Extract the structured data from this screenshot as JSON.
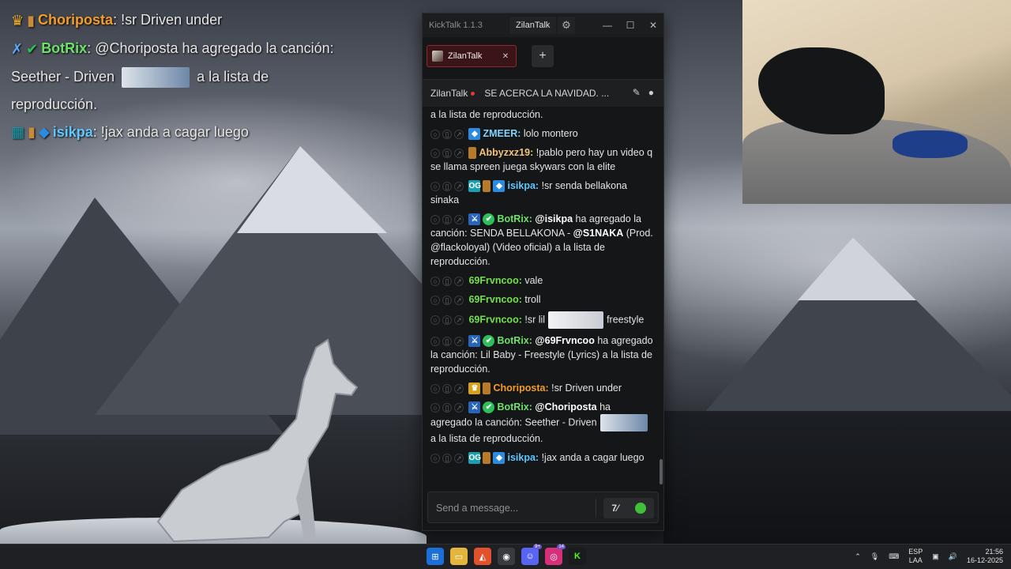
{
  "overlay": {
    "lines": [
      {
        "user": "Choriposta",
        "text": ": !sr Driven under"
      },
      {
        "user": "BotRix",
        "text": ": @Choriposta ha agregado la canción:"
      },
      {
        "text": "Seether - Driven"
      },
      {
        "text": "a la lista de"
      },
      {
        "text": "reproducción."
      },
      {
        "user": "isikpa",
        "text": ": !jax anda a cagar luego"
      }
    ]
  },
  "kicktalk": {
    "app_title": "KickTalk 1.1.3",
    "user": "ZilanTalk",
    "tab_label": "ZilanTalk",
    "add_tab": "+",
    "channel_name": "ZilanTalk",
    "channel_title": "SE ACERCA LA NAVIDAD. ...",
    "input_placeholder": "Send a message...",
    "messages": [
      {
        "text": "a la lista de reproducción."
      },
      {
        "user": "ZMEER:",
        "text": "lolo montero"
      },
      {
        "user": "Abbyzxz19:",
        "text": "!pablo pero hay un video q se llama spreen juega skywars con la elite"
      },
      {
        "user": "isikpa:",
        "text": "!sr senda bellakona sinaka"
      },
      {
        "user": "BotRix:",
        "text_a": "@isikpa",
        "text_b": "ha agregado la canción: SENDA BELLAKONA -",
        "text_c": "@S1NAKA",
        "text_d": "(Prod. @flackoloyal) (Video oficial) a la lista de reproducción."
      },
      {
        "user": "69Frvncoo:",
        "text": "vale"
      },
      {
        "user": "69Frvncoo:",
        "text": "troll"
      },
      {
        "user": "69Frvncoo:",
        "text_a": "!sr lil",
        "text_b": "freestyle"
      },
      {
        "user": "BotRix:",
        "text_a": "@69Frvncoo",
        "text_b": "ha agregado la canción: Lil Baby - Freestyle (Lyrics) a la lista de reproducción."
      },
      {
        "user": "Choriposta:",
        "text": "!sr Driven under"
      },
      {
        "user": "BotRix:",
        "text_a": "@Choriposta",
        "text_b": "ha agregado la canción: Seether - Driven",
        "text_c": "a la lista de reproducción."
      },
      {
        "user": "isikpa:",
        "text": "!jax anda a cagar luego"
      }
    ]
  },
  "taskbar": {
    "lang_1": "ESP",
    "lang_2": "LAA",
    "time": "21:56",
    "date": "16-12-2025",
    "discord_badge": "9+",
    "instagram_badge": "14"
  },
  "colors": {
    "accent_red": "#8c2a2e",
    "kick_green": "#3fbf3a"
  }
}
